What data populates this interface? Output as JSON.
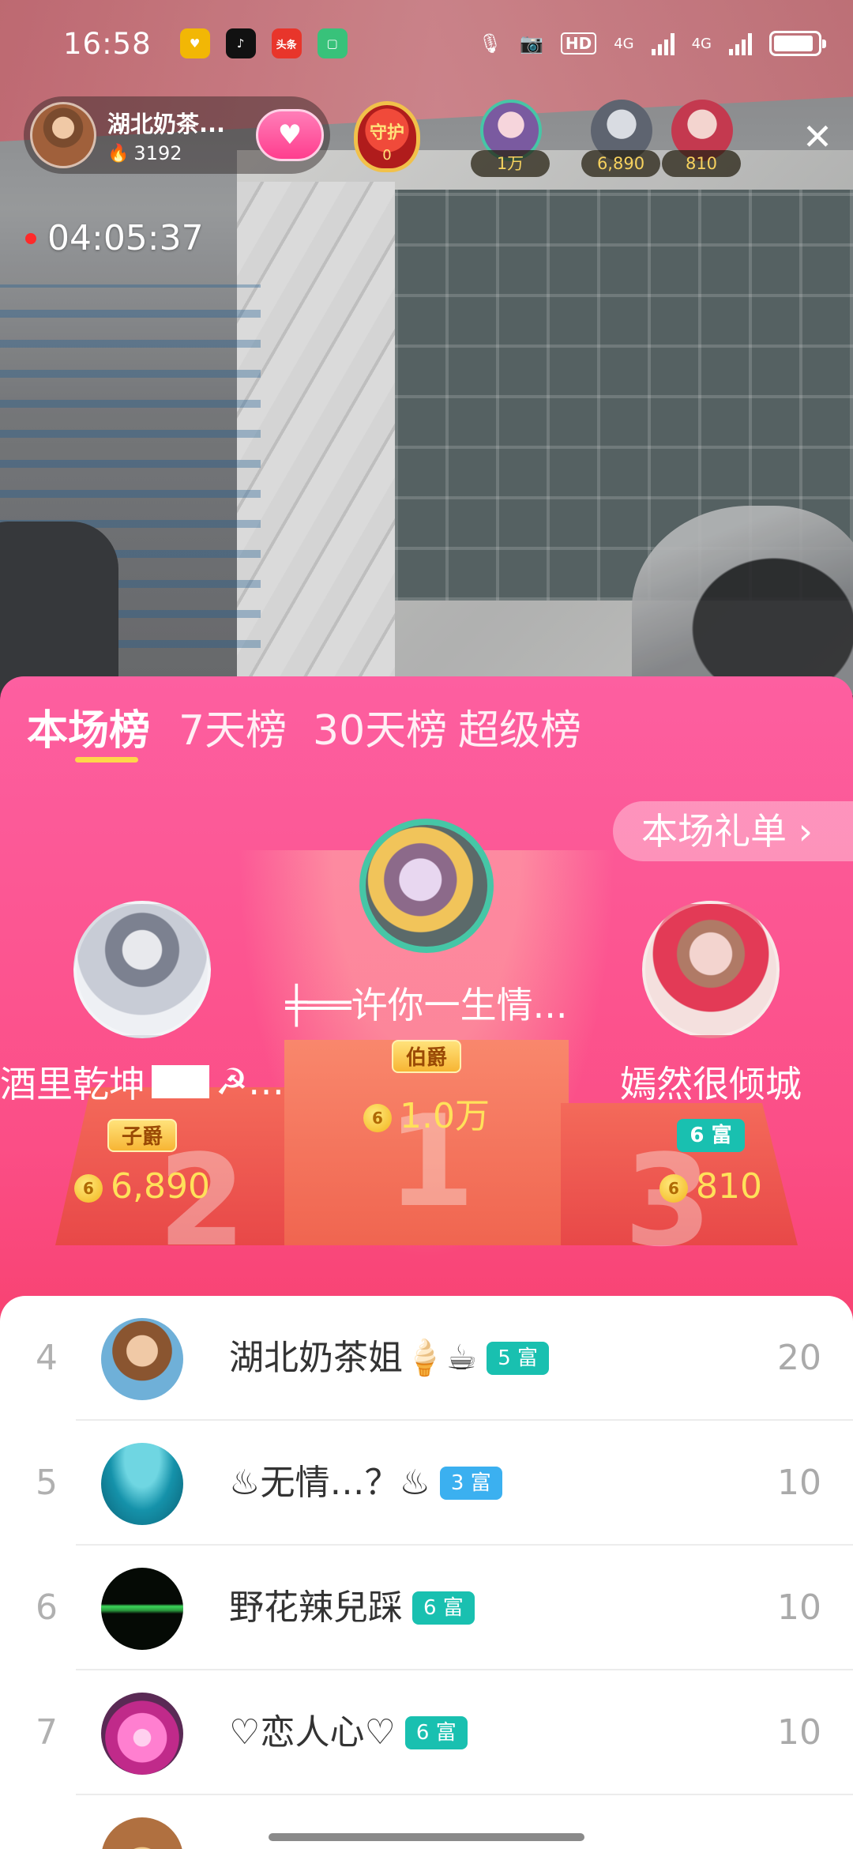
{
  "status_bar": {
    "time": "16:58",
    "apps": [
      {
        "icon": "gift-app-icon",
        "color": "#f2b705"
      },
      {
        "icon": "tiktok-icon",
        "color": "#111111"
      },
      {
        "icon": "toutiao-icon",
        "color": "#e8352b",
        "label": "头条"
      },
      {
        "icon": "square-app-icon",
        "color": "#38c27a"
      }
    ],
    "hd_label": "HD",
    "network_1": "4G",
    "network_2": "4G",
    "battery_level": 0.9
  },
  "live": {
    "host_name": "湖北奶茶...",
    "host_heat": "3192",
    "guard_label": "守护",
    "guard_count": "0",
    "timer": "04:05:37",
    "top_viewers": [
      {
        "score": "1万",
        "colors": [
          "#f6d5dc",
          "#7a5aa0"
        ]
      },
      {
        "score": "6,890",
        "colors": [
          "#d9dce2",
          "#5e6470"
        ]
      },
      {
        "score": "810",
        "colors": [
          "#f3d4cf",
          "#c4394f"
        ]
      }
    ]
  },
  "tabs": [
    "本场榜",
    "7天榜",
    "30天榜",
    "超级榜"
  ],
  "active_tab": 0,
  "gift_list_button": "本场礼单",
  "podium": {
    "first": {
      "name": "╪══许你一生情...",
      "badge": "伯爵",
      "coin": "6",
      "amount": "1.0万"
    },
    "second": {
      "name": "酒里乾坤",
      "badge": "子爵",
      "coin": "6",
      "amount": "6,890"
    },
    "third": {
      "name": "嫣然很倾城",
      "badge": "6 富",
      "coin": "6",
      "amount": "810"
    },
    "numbers": [
      "2",
      "1",
      "3"
    ]
  },
  "list": [
    {
      "rank": "4",
      "name": "湖北奶茶姐🍦☕",
      "tag": "5 富",
      "score": "20",
      "avatar_colors": [
        "#f0c9a6",
        "#8a5530"
      ]
    },
    {
      "rank": "5",
      "name": "♨无情…？♨",
      "tag": "3 富",
      "score": "10",
      "avatar_colors": [
        "#6fd6e2",
        "#0a6b80"
      ]
    },
    {
      "rank": "6",
      "name": "野花辣兒踩",
      "tag": "6 富",
      "score": "10",
      "avatar_colors": [
        "#3bd65a",
        "#050a05"
      ]
    },
    {
      "rank": "7",
      "name": "♡恋人心♡",
      "tag": "6 富",
      "score": "10",
      "avatar_colors": [
        "#ff7fd0",
        "#c02a8a"
      ]
    }
  ]
}
